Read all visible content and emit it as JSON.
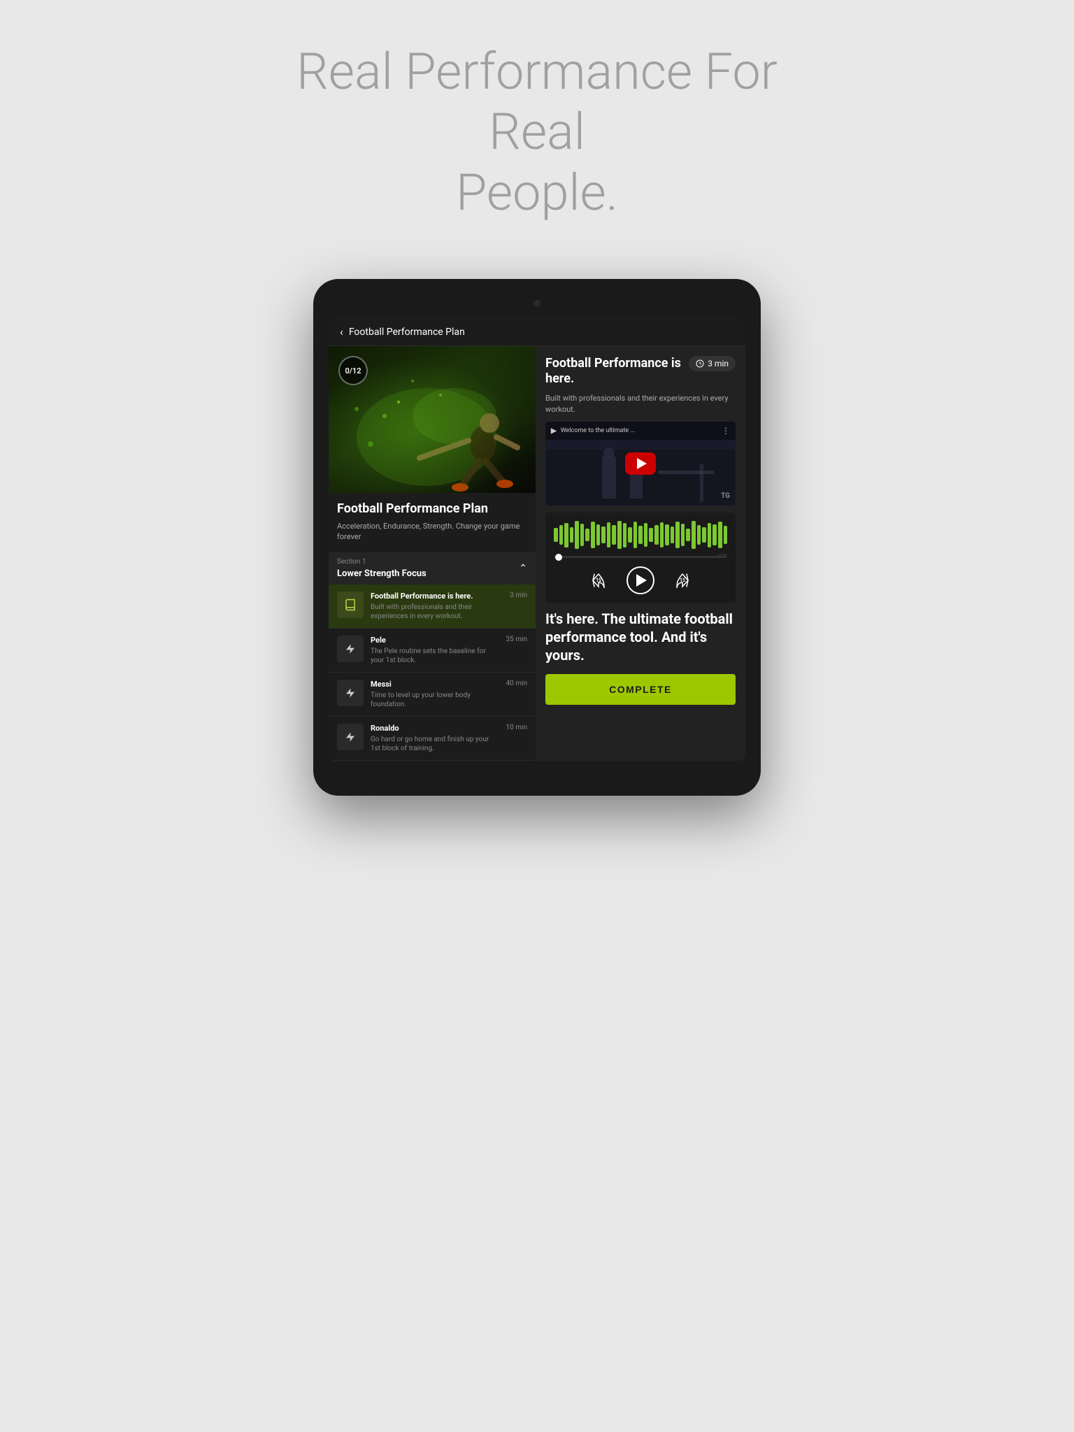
{
  "page": {
    "headline_line1": "Real Performance For Real",
    "headline_line2": "People."
  },
  "nav": {
    "back_label": "Football Performance Plan"
  },
  "plan": {
    "progress": "0/12",
    "title": "Football Performance Plan",
    "subtitle": "Acceleration, Endurance, Strength. Change your game forever"
  },
  "section": {
    "label": "Section 1",
    "name": "Lower Strength Focus"
  },
  "workouts": [
    {
      "name": "Football Performance is here.",
      "desc": "Built with professionals and their experiences in every workout.",
      "duration": "3 min",
      "icon": "book",
      "active": true
    },
    {
      "name": "Pele",
      "desc": "The Pele routine sets the baseline for your 1st block.",
      "duration": "35 min",
      "icon": "bolt",
      "active": false
    },
    {
      "name": "Messi",
      "desc": "Time to level up your lower body foundation.",
      "duration": "40 min",
      "icon": "bolt",
      "active": false
    },
    {
      "name": "Ronaldo",
      "desc": "Go hard or go home and finish up your 1st block of training.",
      "duration": "10 min",
      "icon": "bolt",
      "active": false
    }
  ],
  "right_panel": {
    "title": "Football Performance is here.",
    "time": "3 min",
    "description": "Built with professionals and their experiences in every workout.",
    "video_title": "Welcome to the ultimate ...",
    "video_watermark": "TG",
    "promo_text": "It's here. The ultimate football performance tool. And it's yours.",
    "complete_label": "COMPLETE"
  },
  "waveform_heights": [
    20,
    28,
    35,
    22,
    40,
    32,
    18,
    38,
    30,
    24,
    36,
    28,
    40,
    35,
    22,
    38,
    26,
    34,
    20,
    28,
    36,
    30,
    24,
    38,
    32,
    18,
    40,
    28,
    22,
    35,
    30,
    38,
    26
  ],
  "colors": {
    "accent": "#9dc800",
    "background": "#e8e8e8",
    "tablet_bg": "#1a1a1a",
    "screen_bg": "#1c1c1c"
  }
}
